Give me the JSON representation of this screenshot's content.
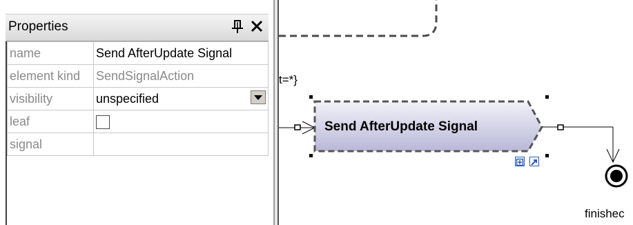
{
  "properties_panel": {
    "title": "Properties",
    "pin_icon": "pin-icon",
    "close_icon": "close-icon",
    "rows": [
      {
        "key": "name",
        "value": "Send AfterUpdate Signal"
      },
      {
        "key": "element kind",
        "value": "SendSignalAction"
      },
      {
        "key": "visibility",
        "value": "unspecified"
      },
      {
        "key": "leaf",
        "value": ""
      },
      {
        "key": "signal",
        "value": ""
      }
    ],
    "leaf_checked": false
  },
  "diagram": {
    "guard_label": "t=*}",
    "action_label": "Send AfterUpdate Signal",
    "final_node_label": "finishec",
    "colors": {
      "action_fill_top": "#f2f2f8",
      "action_fill_bottom": "#b8b8d8",
      "action_border": "#555555",
      "selection_handle": "#000000"
    }
  }
}
